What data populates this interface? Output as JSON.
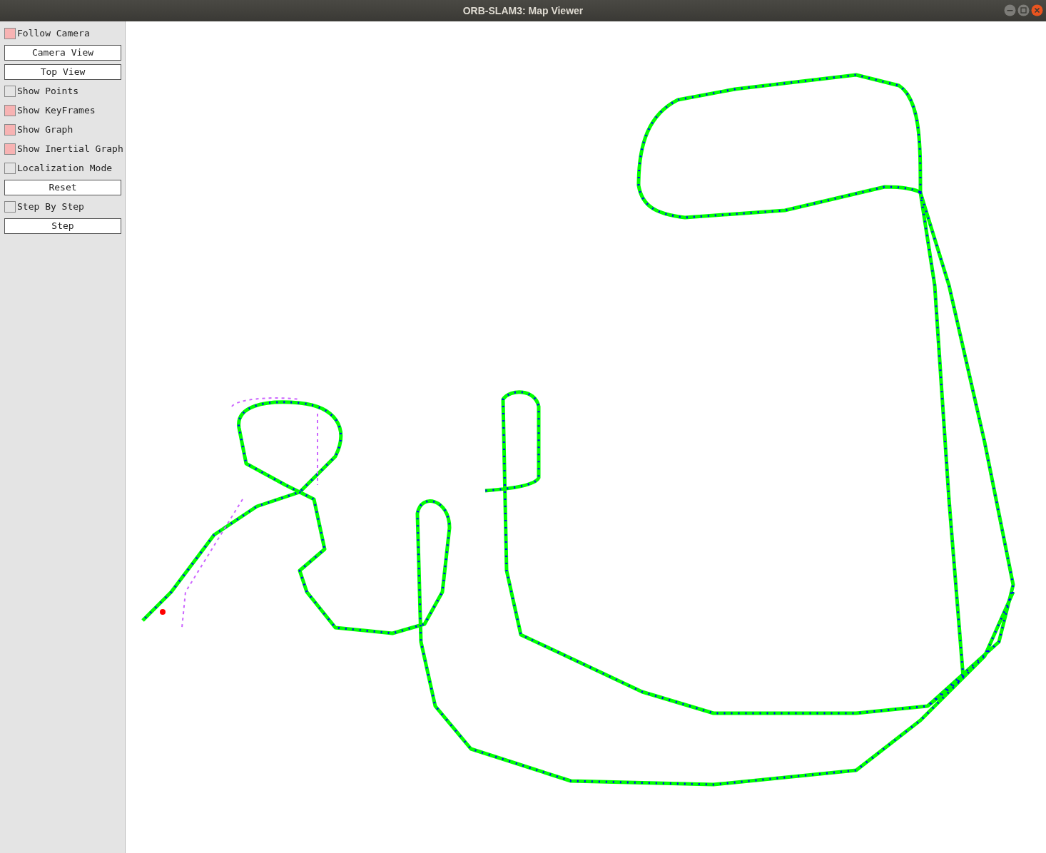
{
  "window": {
    "title": "ORB-SLAM3: Map Viewer"
  },
  "panel": {
    "items": [
      {
        "kind": "checkbox",
        "label": "Follow Camera",
        "checked": true
      },
      {
        "kind": "button",
        "label": "Camera View"
      },
      {
        "kind": "button",
        "label": "Top View"
      },
      {
        "kind": "checkbox",
        "label": "Show Points",
        "checked": false
      },
      {
        "kind": "checkbox",
        "label": "Show KeyFrames",
        "checked": true
      },
      {
        "kind": "checkbox",
        "label": "Show Graph",
        "checked": true
      },
      {
        "kind": "checkbox",
        "label": "Show Inertial Graph",
        "checked": true
      },
      {
        "kind": "checkbox",
        "label": "Localization Mode",
        "checked": false
      },
      {
        "kind": "button",
        "label": "Reset"
      },
      {
        "kind": "checkbox",
        "label": "Step By Step",
        "checked": false
      },
      {
        "kind": "button",
        "label": "Step"
      }
    ]
  }
}
